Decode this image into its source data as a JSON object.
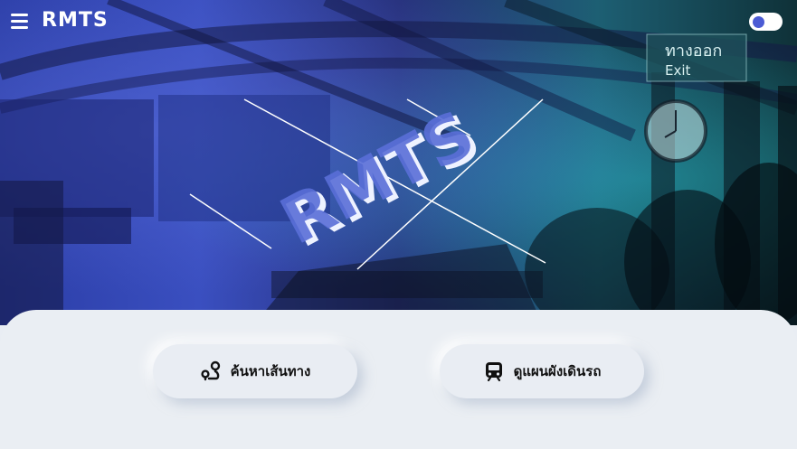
{
  "app": {
    "brand": "RMTS",
    "hero_logo_text": "RMTS",
    "sign_thai": "ทางออก",
    "sign_exit": "Exit"
  },
  "header": {
    "menu_icon": "hamburger-menu-icon",
    "theme_toggle": {
      "state": "on",
      "knob_color": "#4b5bd4"
    }
  },
  "actions": {
    "route_label": "ค้นหาเส้นทาง",
    "route_icon": "route-pin-icon",
    "map_label": "ดูแผนผังเดินรถ",
    "map_icon": "train-icon"
  },
  "colors": {
    "hero_left": "#3a4fc0",
    "hero_right": "#0f3138",
    "panel_bg": "#eaeef3"
  }
}
